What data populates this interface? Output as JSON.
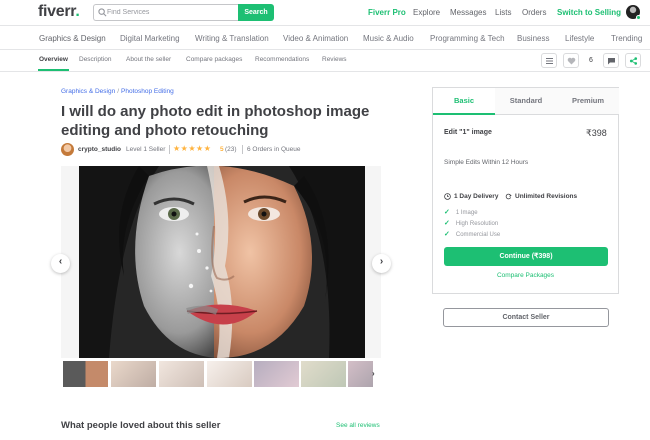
{
  "header": {
    "logo": "fiverr",
    "logo_dot": ".",
    "search_placeholder": "Find Services",
    "search_button": "Search",
    "links": [
      "Fiverr Pro",
      "Explore",
      "Messages",
      "Lists",
      "Orders"
    ],
    "switch_selling": "Switch to Selling"
  },
  "categories": [
    "Graphics & Design",
    "Digital Marketing",
    "Writing & Translation",
    "Video & Animation",
    "Music & Audio",
    "Programming & Tech",
    "Business",
    "Lifestyle",
    "Trending"
  ],
  "subnav": {
    "tabs": [
      "Overview",
      "Description",
      "About the seller",
      "Compare packages",
      "Recommendations",
      "Reviews"
    ],
    "save_count": "6"
  },
  "gig": {
    "breadcrumb": [
      "Graphics & Design",
      "Photoshop Editing"
    ],
    "breadcrumb_sep": "/",
    "title": "I will do any photo edit in photoshop image editing and photo retouching",
    "seller_name": "crypto_studio",
    "seller_level": "Level 1 Seller",
    "rating": "5",
    "rating_count": "(23)",
    "rating_stars": 5,
    "queue": "6 Orders in Queue",
    "loved_title": "What people loved about this seller",
    "see_all": "See all reviews"
  },
  "package": {
    "tabs": [
      "Basic",
      "Standard",
      "Premium"
    ],
    "name": "Edit \"1\" image",
    "price": "₹398",
    "description": "Simple Edits Within 12 Hours",
    "delivery": "1 Day Delivery",
    "revisions": "Unlimited Revisions",
    "features": [
      "1 Image",
      "High Resolution",
      "Commercial Use"
    ],
    "continue": "Continue (₹398)",
    "compare": "Compare Packages"
  },
  "contact_seller": "Contact Seller",
  "icons": {
    "stars": "★★★★★",
    "check": "✓",
    "prev": "‹",
    "next": "›"
  },
  "colors": {
    "brand": "#1dbf73",
    "star": "#ffb33e",
    "link": "#446ee7"
  }
}
